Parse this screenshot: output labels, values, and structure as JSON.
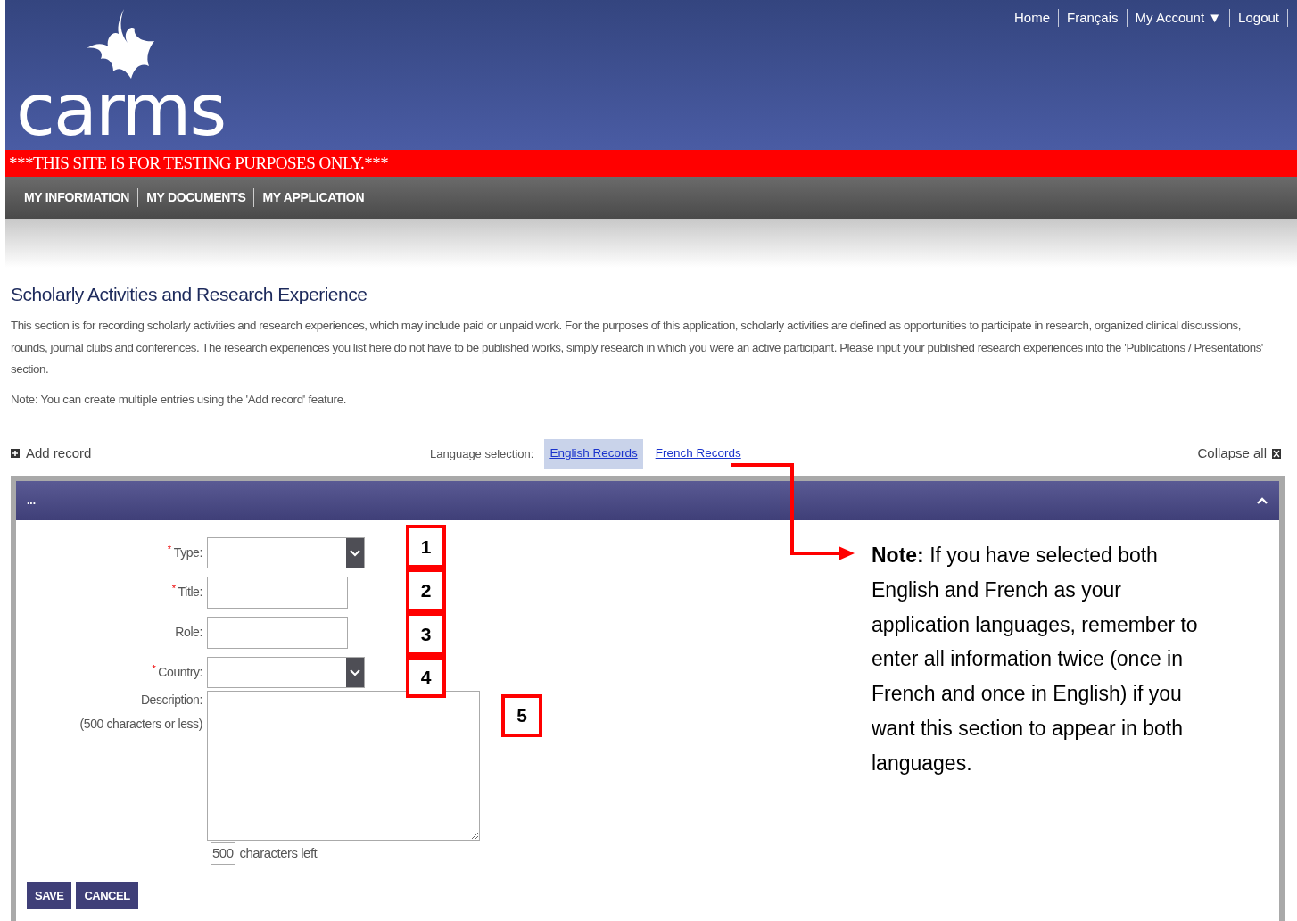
{
  "header": {
    "logo": "carms",
    "links": [
      "Home",
      "Français",
      "My Account ▼",
      "Logout"
    ]
  },
  "test_banner": "***THIS SITE IS FOR TESTING PURPOSES ONLY.***",
  "nav": [
    "MY INFORMATION",
    "MY DOCUMENTS",
    "MY APPLICATION"
  ],
  "page": {
    "title": "Scholarly Activities and Research Experience",
    "description": "This section is for recording scholarly activities and research experiences, which may include paid or unpaid work. For the purposes of this application, scholarly activities are defined as opportunities to participate in research, organized clinical discussions, rounds, journal clubs and conferences. The research experiences you list here do not have to be published works, simply research in which you were an active participant. Please input your published research experiences into the 'Publications / Presentations' section.",
    "note": "Note: You can create multiple entries using the 'Add record' feature."
  },
  "toolbar": {
    "add_record": "Add record",
    "language_label": "Language selection:",
    "language_tabs": [
      {
        "label": "English Records",
        "selected": true
      },
      {
        "label": "French Records",
        "selected": false
      }
    ],
    "collapse_all": "Collapse all"
  },
  "record": {
    "header": "...",
    "expanded": true,
    "required_mark": "*",
    "fields": [
      {
        "kind": "select",
        "label": "Type:",
        "required": true
      },
      {
        "kind": "text",
        "label": "Title:",
        "required": true
      },
      {
        "kind": "text",
        "label": "Role:",
        "required": false
      },
      {
        "kind": "select",
        "label": "Country:",
        "required": true
      },
      {
        "kind": "textarea",
        "label": "Description:",
        "hint": "(500 characters or less)",
        "required": false
      }
    ],
    "counter": "500",
    "counter_label": "characters left",
    "buttons": [
      "SAVE",
      "CANCEL"
    ]
  },
  "annotations": {
    "markers": [
      "1",
      "2",
      "3",
      "4",
      "5"
    ],
    "note": "**Note:** If you have selected both English and French as your application languages, remember to enter all information twice (once in French and once in English) if you want this section to appear in both languages."
  }
}
